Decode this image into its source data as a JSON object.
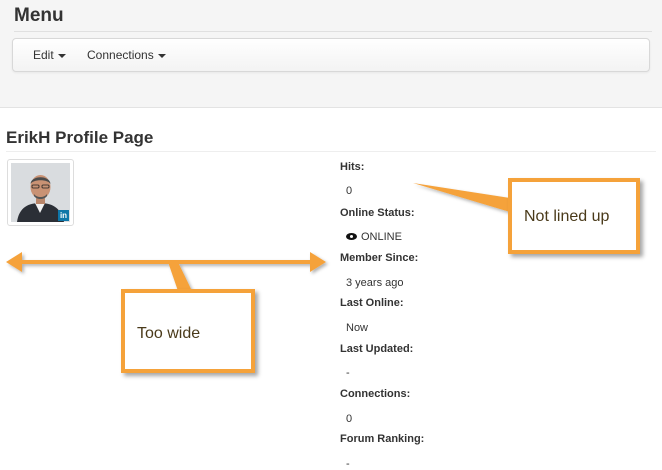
{
  "menu": {
    "title": "Menu",
    "items": [
      {
        "label": "Edit"
      },
      {
        "label": "Connections"
      }
    ]
  },
  "profile": {
    "title": "ErikH Profile Page",
    "avatar_badge": "in",
    "fields": [
      {
        "label": "Hits:",
        "value": "0"
      },
      {
        "label": "Online Status:",
        "value": "ONLINE"
      },
      {
        "label": "Member Since:",
        "value": "3 years ago"
      },
      {
        "label": "Last Online:",
        "value": "Now"
      },
      {
        "label": "Last Updated:",
        "value": "-"
      },
      {
        "label": "Connections:",
        "value": "0"
      },
      {
        "label": "Forum Ranking:",
        "value": "-"
      }
    ]
  },
  "annotations": {
    "not_lined_up": "Not lined up",
    "too_wide": "Too wide"
  },
  "colors": {
    "annotation": "#f5a23a",
    "online": "#3c9a2a"
  }
}
